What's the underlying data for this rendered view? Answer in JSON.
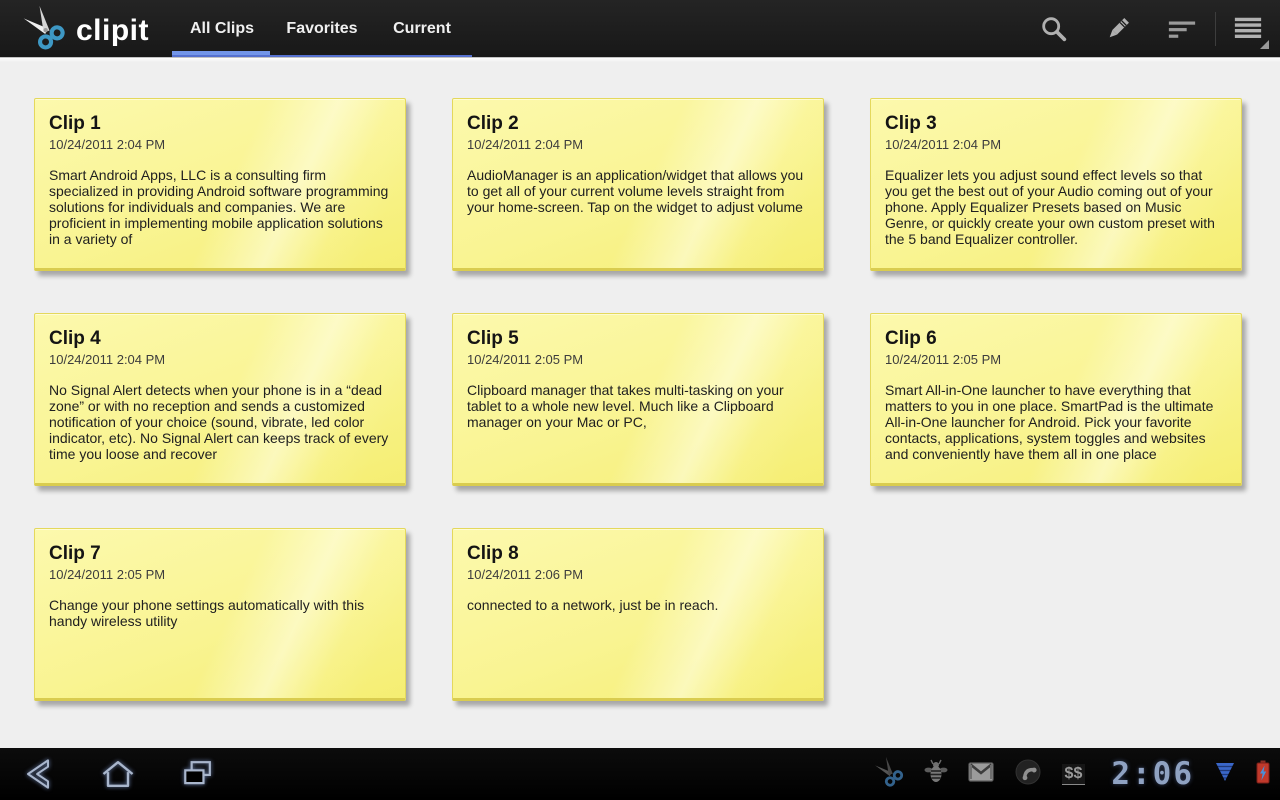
{
  "action_bar": {
    "logo_text": "clipit",
    "tabs": [
      {
        "label": "All Clips",
        "active": true
      },
      {
        "label": "Favorites",
        "active": false
      },
      {
        "label": "Current",
        "active": false
      }
    ],
    "icons": [
      "search",
      "edit-pencil",
      "sort",
      "overflow-menu"
    ],
    "accent_color": "#7295e9"
  },
  "clips": [
    {
      "title": "Clip 1",
      "timestamp": "10/24/2011 2:04 PM",
      "body": "Smart Android Apps, LLC is a consulting firm specialized in providing Android software programming solutions for individuals and companies. We are proficient in implementing mobile application solutions in a variety of"
    },
    {
      "title": "Clip 2",
      "timestamp": "10/24/2011 2:04 PM",
      "body": "AudioManager is an application/widget that allows you to get all of your current volume levels straight from your home-screen. Tap on the widget to adjust volume"
    },
    {
      "title": "Clip 3",
      "timestamp": "10/24/2011 2:04 PM",
      "body": "Equalizer lets you adjust sound effect levels so that you get the best out of your Audio coming out of your phone. Apply Equalizer Presets based on Music Genre, or quickly create your own custom preset with the 5 band Equalizer controller."
    },
    {
      "title": "Clip 4",
      "timestamp": "10/24/2011 2:04 PM",
      "body": "No Signal Alert detects when your phone is in a “dead zone” or with no reception and sends a customized notification of your choice (sound, vibrate, led color indicator, etc). No Signal Alert can keeps track of every time you loose and recover"
    },
    {
      "title": "Clip 5",
      "timestamp": "10/24/2011 2:05 PM",
      "body": "Clipboard manager that takes multi-tasking on your tablet to a whole new level. Much like a Clipboard manager on your Mac or PC,"
    },
    {
      "title": "Clip 6",
      "timestamp": "10/24/2011 2:05 PM",
      "body": "Smart All-in-One launcher to have everything that matters to you in one place. SmartPad is the ultimate All-in-One launcher for Android. Pick your favorite contacts, applications, system toggles and websites and conveniently have them all in one place"
    },
    {
      "title": "Clip 7",
      "timestamp": "10/24/2011 2:05 PM",
      "body": "Change your phone settings automatically with this handy wireless utility"
    },
    {
      "title": "Clip 8",
      "timestamp": "10/24/2011 2:06 PM",
      "body": "connected to a network, just be in reach."
    }
  ],
  "note_style": {
    "paper_color": "#f8f38c",
    "edge_color": "#d9cc4f"
  },
  "system_bar": {
    "clock": "2:06",
    "dollar_label": "$$",
    "nav_buttons": [
      "back",
      "home",
      "recent-apps"
    ],
    "status_icons": [
      "clipit-scissors",
      "bee",
      "gmail",
      "phone",
      "dollar",
      "signal",
      "battery-charging"
    ],
    "signal_color": "#3a67c9",
    "battery_color": "#c0392b"
  }
}
